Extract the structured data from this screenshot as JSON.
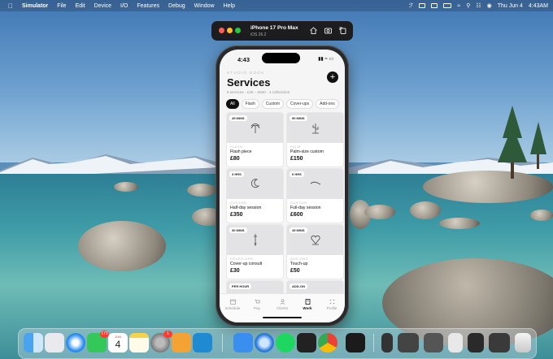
{
  "menubar": {
    "app": "Simulator",
    "items": [
      "File",
      "Edit",
      "Device",
      "I/O",
      "Features",
      "Debug",
      "Window",
      "Help"
    ],
    "date": "Thu Jun 4",
    "time": "4:43AM"
  },
  "simulator": {
    "device_name": "iPhone 17 Pro Max",
    "os_version": "iOS 26.2"
  },
  "phone": {
    "status_time": "4:43",
    "eyebrow": "STUDIO BOOK",
    "title": "Services",
    "subtitle": "8 services · £25 – £600 · 4 collections",
    "chips": [
      {
        "label": "All",
        "active": true
      },
      {
        "label": "Flash",
        "active": false
      },
      {
        "label": "Custom",
        "active": false
      },
      {
        "label": "Cover-ups",
        "active": false
      },
      {
        "label": "Add-ons",
        "active": false
      }
    ],
    "cards": [
      {
        "duration": "45 MINS",
        "category": "FLASH",
        "name": "Flash piece",
        "price": "£80",
        "icon": "palm-tree-icon"
      },
      {
        "duration": "90 MINS",
        "category": "PALM",
        "name": "Palm-size custom",
        "price": "£150",
        "icon": "cactus-icon"
      },
      {
        "duration": "3 HRS",
        "category": "CUSTOM",
        "name": "Half-day session",
        "price": "£350",
        "icon": "moon-icon"
      },
      {
        "duration": "6 HRS",
        "category": "CUSTOM",
        "name": "Full-day session",
        "price": "£600",
        "icon": "line-icon"
      },
      {
        "duration": "30 MINS",
        "category": "COVER-UPS",
        "name": "Cover-up consult",
        "price": "£30",
        "icon": "pen-icon"
      },
      {
        "duration": "45 MINS",
        "category": "ADD-ONS",
        "name": "Touch-up",
        "price": "£50",
        "icon": "heart-icon"
      },
      {
        "duration": "PER HOUR",
        "category": "",
        "name": "",
        "price": "",
        "icon": ""
      },
      {
        "duration": "ADD-ON",
        "category": "",
        "name": "",
        "price": "",
        "icon": ""
      }
    ],
    "tabs": [
      {
        "label": "Schedule",
        "active": false
      },
      {
        "label": "Pay",
        "active": false
      },
      {
        "label": "Clients",
        "active": false
      },
      {
        "label": "Work",
        "active": true
      },
      {
        "label": "Profile",
        "active": false
      }
    ]
  },
  "dock": {
    "messages_badge": "173",
    "calendar_month": "JUN",
    "calendar_day": "4",
    "settings_badge": "1"
  }
}
